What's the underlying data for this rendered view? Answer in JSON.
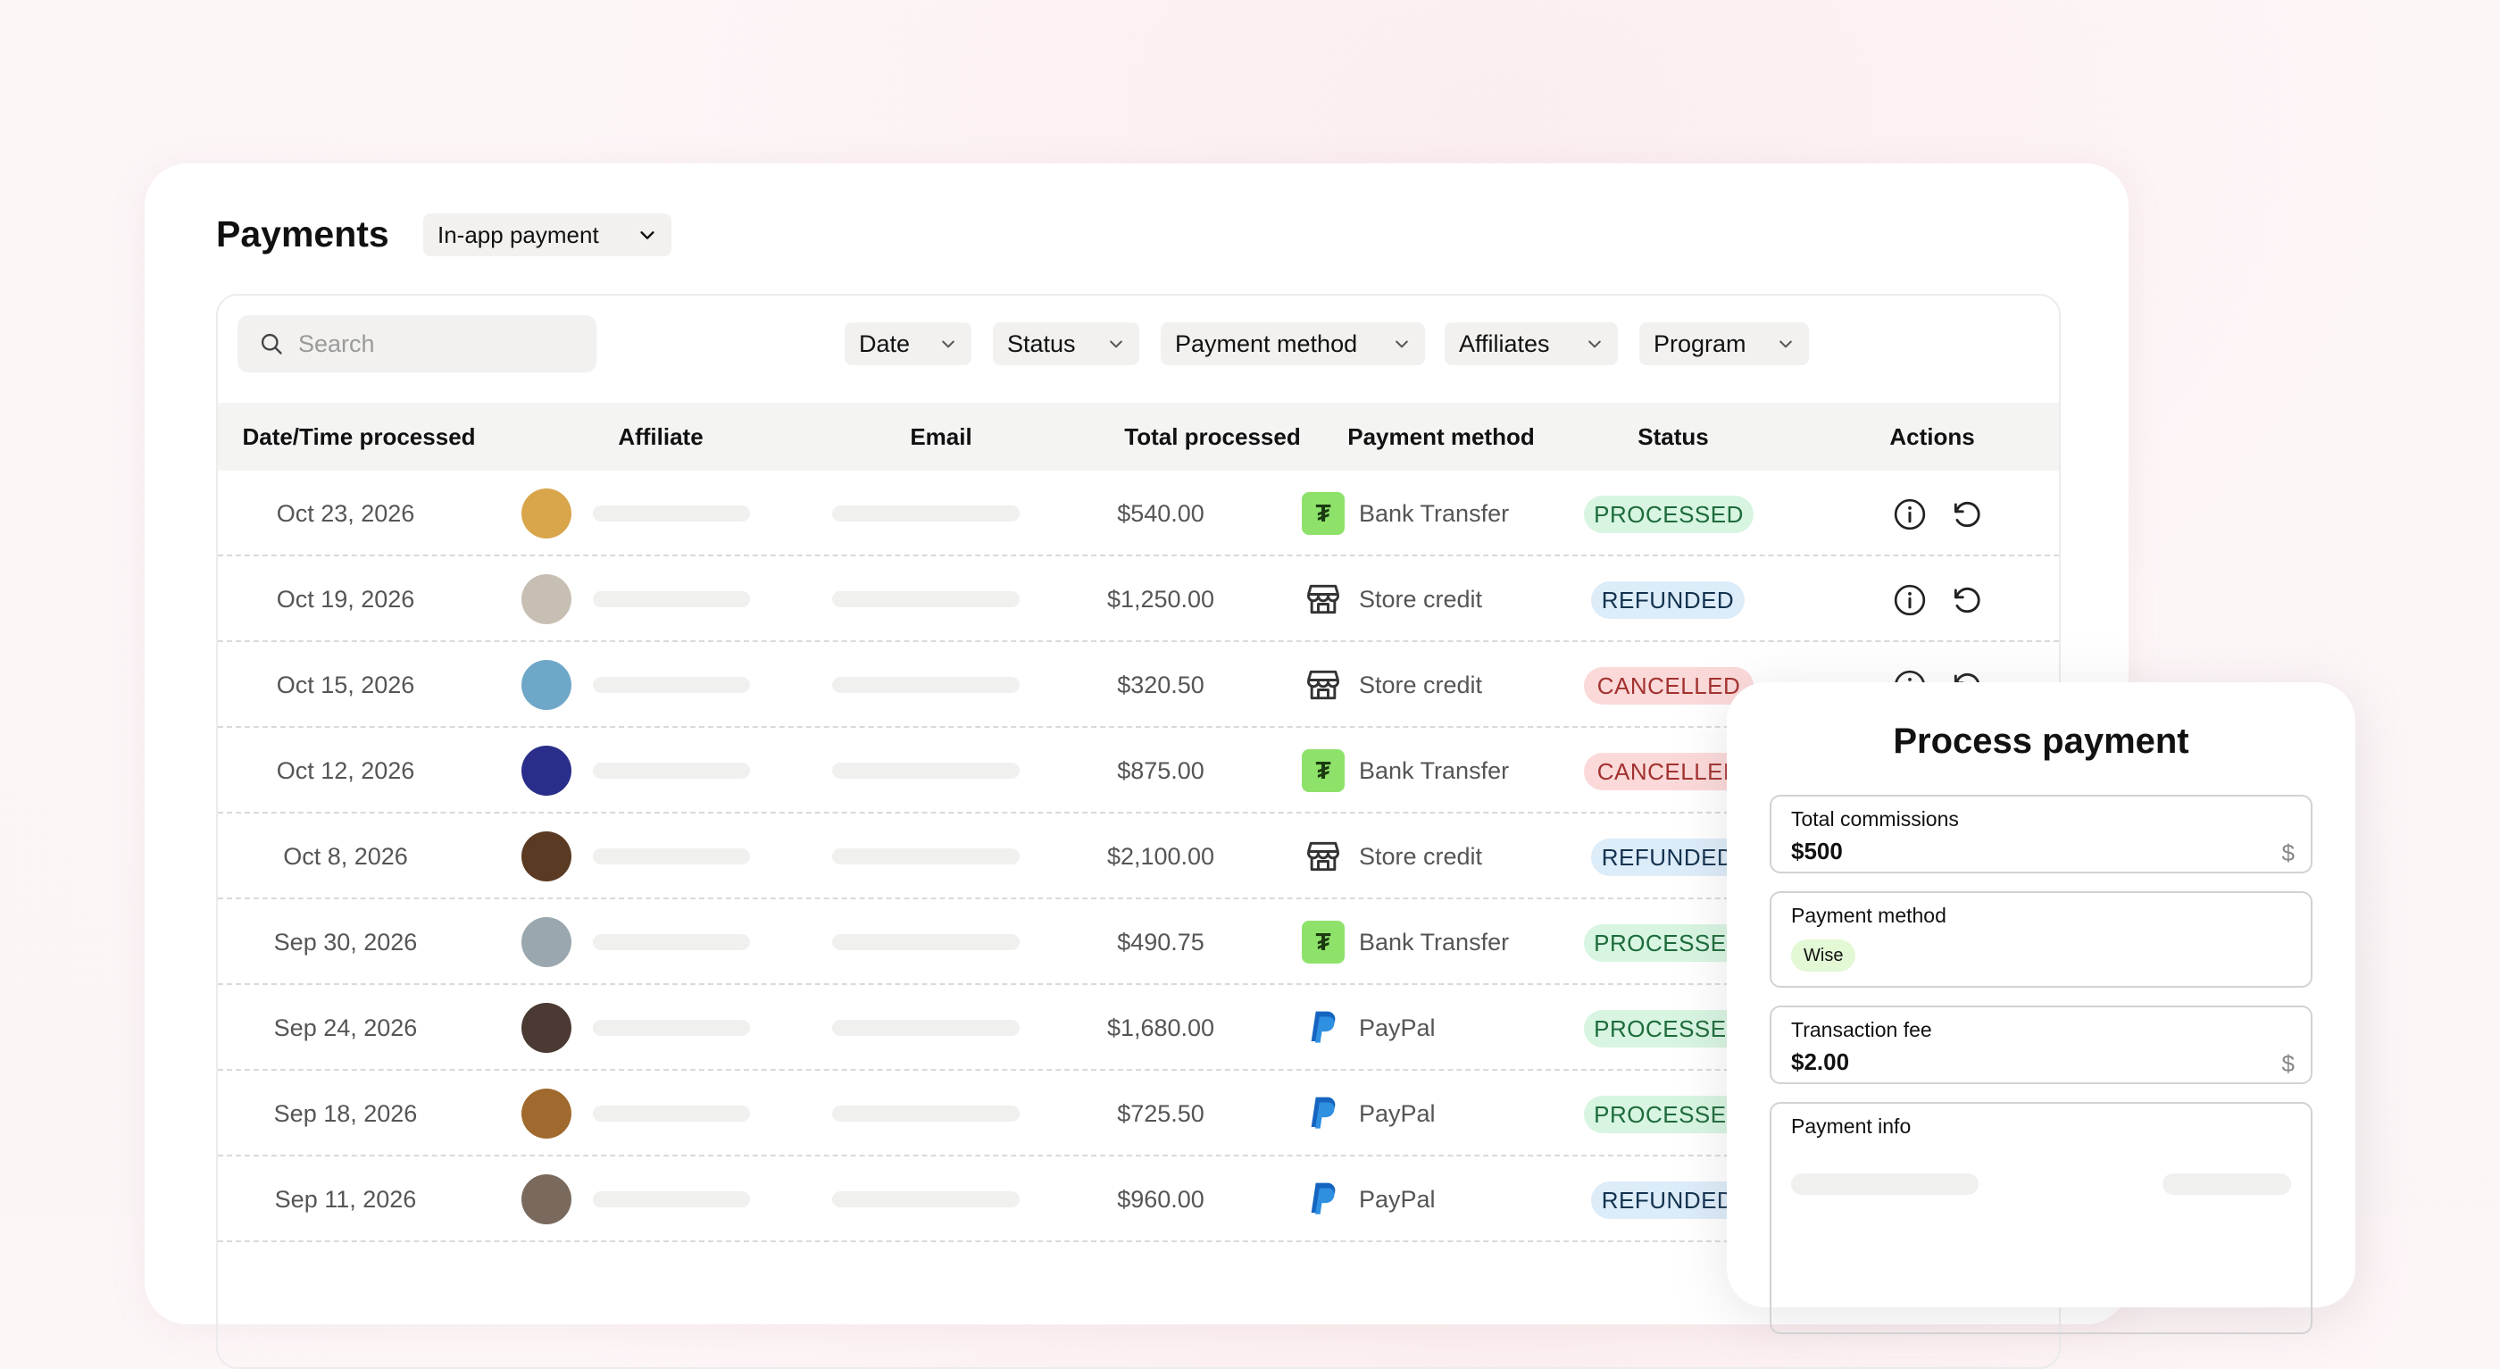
{
  "page": {
    "title": "Payments",
    "payment_type_dropdown": "In-app payment"
  },
  "search": {
    "placeholder": "Search"
  },
  "filters": [
    {
      "label": "Date"
    },
    {
      "label": "Status"
    },
    {
      "label": "Payment method"
    },
    {
      "label": "Affiliates"
    },
    {
      "label": "Program"
    }
  ],
  "columns": [
    "Date/Time processed",
    "Affiliate",
    "Email",
    "Total processed",
    "Payment method",
    "Status",
    "Actions"
  ],
  "rows": [
    {
      "date": "Oct 23, 2026",
      "total": "$540.00",
      "method": "Bank Transfer",
      "method_icon": "wise-icon",
      "status": "PROCESSED",
      "avatar": "#d8a54b"
    },
    {
      "date": "Oct 19, 2026",
      "total": "$1,250.00",
      "method": "Store credit",
      "method_icon": "store-icon",
      "status": "REFUNDED",
      "avatar": "#c8bfb4"
    },
    {
      "date": "Oct 15, 2026",
      "total": "$320.50",
      "method": "Store credit",
      "method_icon": "store-icon",
      "status": "CANCELLED",
      "avatar": "#6fa7c9"
    },
    {
      "date": "Oct 12, 2026",
      "total": "$875.00",
      "method": "Bank Transfer",
      "method_icon": "wise-icon",
      "status": "CANCELLED",
      "avatar": "#2a2e8a"
    },
    {
      "date": "Oct 8, 2026",
      "total": "$2,100.00",
      "method": "Store credit",
      "method_icon": "store-icon",
      "status": "REFUNDED",
      "avatar": "#5a3a22"
    },
    {
      "date": "Sep 30, 2026",
      "total": "$490.75",
      "method": "Bank Transfer",
      "method_icon": "wise-icon",
      "status": "PROCESSED",
      "avatar": "#9aa7ae"
    },
    {
      "date": "Sep 24, 2026",
      "total": "$1,680.00",
      "method": "PayPal",
      "method_icon": "paypal-icon",
      "status": "PROCESSED",
      "avatar": "#4b3a34"
    },
    {
      "date": "Sep 18, 2026",
      "total": "$725.50",
      "method": "PayPal",
      "method_icon": "paypal-icon",
      "status": "PROCESSED",
      "avatar": "#a06a2e"
    },
    {
      "date": "Sep 11, 2026",
      "total": "$960.00",
      "method": "PayPal",
      "method_icon": "paypal-icon",
      "status": "REFUNDED",
      "avatar": "#7a6a5e"
    }
  ],
  "process_panel": {
    "title": "Process payment",
    "total_commissions": {
      "label": "Total commissions",
      "value": "$500",
      "suffix": "$"
    },
    "payment_method": {
      "label": "Payment method",
      "chip": "Wise"
    },
    "transaction_fee": {
      "label": "Transaction fee",
      "value": "$2.00",
      "suffix": "$"
    },
    "payment_info": {
      "label": "Payment info"
    }
  },
  "colors": {
    "processed_bg": "#d7f5e1",
    "refunded_bg": "#dcecf9",
    "cancelled_bg": "#fbd9d9",
    "wise_green": "#8ee26a",
    "paypal_blue": "#1565c0"
  }
}
